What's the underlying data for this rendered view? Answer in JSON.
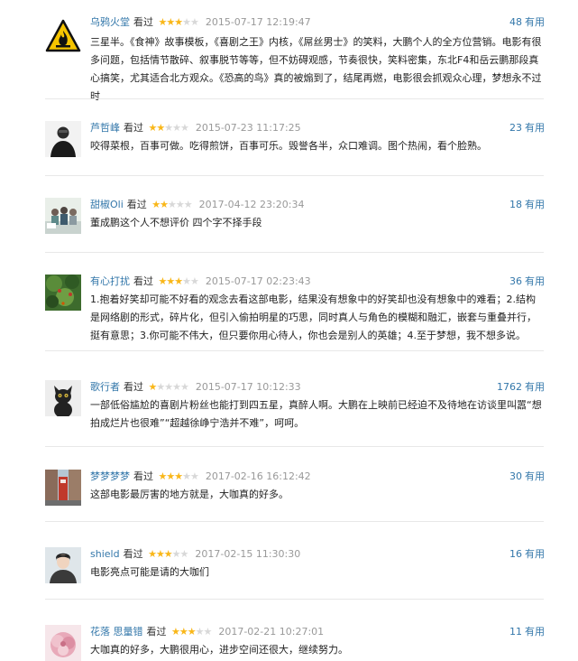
{
  "reviews": [
    {
      "author": "乌鸦火堂",
      "verb": "看过",
      "rating": 3,
      "date": "2015-07-17 12:19:47",
      "useful_count": "48",
      "useful_label": "有用",
      "avatar": "hazard-flame-icon",
      "text": "三星半。《食神》故事模板，《喜剧之王》内核，《屌丝男士》的笑料，大鹏个人的全方位营销。电影有很多问题，包括情节散碎、叙事脱节等等，但不妨碍观感，节奏很快，笑料密集，东北F4和岳云鹏那段真心搞笑，尤其适合北方观众。《恐高的鸟》真的被煽到了，结尾再燃，电影很会抓观众心理，梦想永不过时"
    },
    {
      "author": "芦哲峰",
      "verb": "看过",
      "rating": 2,
      "date": "2015-07-23 11:17:25",
      "useful_count": "23",
      "useful_label": "有用",
      "avatar": "man-portrait",
      "text": "咬得菜根，百事可做。吃得煎饼，百事可乐。毁誉各半，众口难调。图个热闹，看个脸熟。"
    },
    {
      "author": "甜椒Oli",
      "verb": "看过",
      "rating": 2,
      "date": "2017-04-12 23:20:34",
      "useful_count": "18",
      "useful_label": "有用",
      "avatar": "group-photo",
      "text": "董成鹏这个人不想评价 四个字不择手段"
    },
    {
      "author": "有心打扰",
      "verb": "看过",
      "rating": 3,
      "date": "2015-07-17 02:23:43",
      "useful_count": "36",
      "useful_label": "有用",
      "avatar": "garden-photo",
      "text": "1.抱着好笑却可能不好看的观念去看这部电影，结果没有想象中的好笑却也没有想象中的难看；2.结构是网络剧的形式，碎片化，但引入偷拍明星的巧思，同时真人与角色的模糊和融汇，嵌套与重叠并行，挺有意思；3.你可能不伟大，但只要你用心待人，你也会是别人的英雄；4.至于梦想，我不想多说。"
    },
    {
      "author": "歌行者",
      "verb": "看过",
      "rating": 1,
      "date": "2015-07-17 10:12:33",
      "useful_count": "1762",
      "useful_label": "有用",
      "avatar": "black-cat",
      "text": "一部低俗尴尬的喜剧片粉丝也能打到四五星，真醉人啊。大鹏在上映前已经迫不及待地在访谈里叫嚣“想拍成烂片也很难”“超越徐峥宁浩并不难”，呵呵。"
    },
    {
      "author": "梦梦梦梦",
      "verb": "看过",
      "rating": 3,
      "date": "2017-02-16 16:12:42",
      "useful_count": "30",
      "useful_label": "有用",
      "avatar": "street-photo",
      "text": "这部电影最厉害的地方就是，大咖真的好多。"
    },
    {
      "author": "shield",
      "verb": "看过",
      "rating": 3,
      "date": "2017-02-15 11:30:30",
      "useful_count": "16",
      "useful_label": "有用",
      "avatar": "young-man",
      "text": "电影亮点可能是请的大咖们"
    },
    {
      "author": "花落 思量错",
      "verb": "看过",
      "rating": 3,
      "date": "2017-02-21 10:27:01",
      "useful_count": "11",
      "useful_label": "有用",
      "avatar": "pink-flower",
      "text": "大咖真的好多，大鹏很用心，进步空间还很大，继续努力。"
    }
  ]
}
